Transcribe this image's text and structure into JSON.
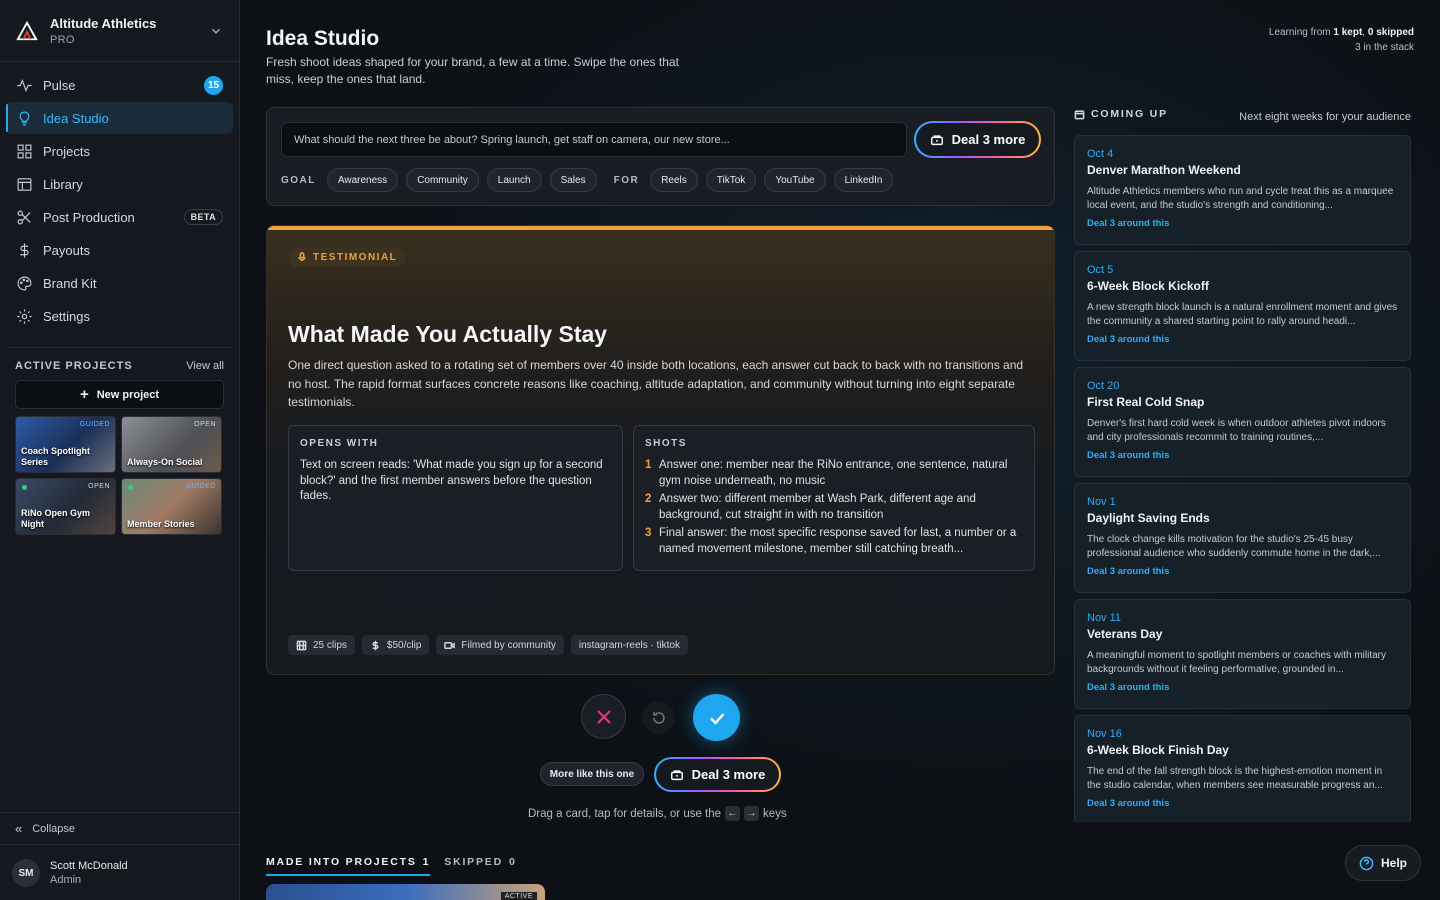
{
  "brand": {
    "name": "Altitude Athletics",
    "plan": "PRO"
  },
  "nav": [
    {
      "label": "Pulse",
      "icon": "pulse-icon",
      "badge": "15"
    },
    {
      "label": "Idea Studio",
      "icon": "lightbulb-icon",
      "active": true
    },
    {
      "label": "Projects",
      "icon": "grid-icon"
    },
    {
      "label": "Library",
      "icon": "library-icon"
    },
    {
      "label": "Post Production",
      "icon": "scissors-icon",
      "tag": "BETA"
    },
    {
      "label": "Payouts",
      "icon": "dollar-icon"
    },
    {
      "label": "Brand Kit",
      "icon": "palette-icon"
    },
    {
      "label": "Settings",
      "icon": "gear-icon"
    }
  ],
  "active_projects": {
    "title": "ACTIVE PROJECTS",
    "view_all": "View all",
    "new_project": "New project",
    "items": [
      {
        "label": "Coach Spotlight Series",
        "status": "GUIDED"
      },
      {
        "label": "Always-On Social",
        "status": "OPEN"
      },
      {
        "label": "RiNo Open Gym Night",
        "status": "OPEN"
      },
      {
        "label": "Member Stories",
        "status": "GUIDED"
      }
    ]
  },
  "collapse_label": "Collapse",
  "user": {
    "initials": "SM",
    "name": "Scott McDonald",
    "role": "Admin"
  },
  "header": {
    "title": "Idea Studio",
    "subtitle": "Fresh shoot ideas shaped for your brand, a few at a time. Swipe the ones that miss, keep the ones that land.",
    "learning_prefix": "Learning from",
    "learning_kept": "1 kept",
    "learning_skipped": "0 skipped",
    "stack": "3 in the stack"
  },
  "prompt": {
    "placeholder": "What should the next three be about? Spring launch, get staff on camera, our new store...",
    "deal_label": "Deal 3 more",
    "goal_label": "GOAL",
    "goals": [
      "Awareness",
      "Community",
      "Launch",
      "Sales"
    ],
    "for_label": "FOR",
    "platforms": [
      "Reels",
      "TikTok",
      "YouTube",
      "LinkedIn"
    ]
  },
  "card": {
    "tag": "TESTIMONIAL",
    "title": "What Made You Actually Stay",
    "description": "One direct question asked to a rotating set of members over 40 inside both locations, each answer cut back to back with no transitions and no host. The rapid format surfaces concrete reasons like coaching, altitude adaptation, and community without turning into eight separate testimonials.",
    "opens_with_head": "OPENS WITH",
    "opens_with": "Text on screen reads: 'What made you sign up for a second block?' and the first member answers before the question fades.",
    "shots_head": "SHOTS",
    "shots": [
      "Answer one: member near the RiNo entrance, one sentence, natural gym noise underneath, no music",
      "Answer two: different member at Wash Park, different age and background, cut straight in with no transition",
      "Final answer: the most specific response saved for last, a number or a named movement milestone, member still catching breath..."
    ],
    "meta": {
      "clips": "25 clips",
      "rate": "$50/clip",
      "filmed_by": "Filmed by community",
      "platforms": "instagram-reels · tiktok"
    },
    "accent": "#f2a13a"
  },
  "actions": {
    "more_like": "More like this one",
    "deal_label": "Deal 3 more",
    "hint_before": "Drag a card, tap for details, or use the",
    "hint_after": "keys",
    "key_left": "←",
    "key_right": "→"
  },
  "tabs": [
    {
      "label": "MADE INTO PROJECTS",
      "count": "1",
      "active": true
    },
    {
      "label": "SKIPPED",
      "count": "0"
    }
  ],
  "peek_status": "ACTIVE",
  "coming_up": {
    "title": "COMING UP",
    "subtitle": "Next eight weeks for your audience",
    "link_label": "Deal 3 around this",
    "events": [
      {
        "date": "Oct 4",
        "title": "Denver Marathon Weekend",
        "desc": "Altitude Athletics members who run and cycle treat this as a marquee local event, and the studio's strength and conditioning..."
      },
      {
        "date": "Oct 5",
        "title": "6-Week Block Kickoff",
        "desc": "A new strength block launch is a natural enrollment moment and gives the community a shared starting point to rally around headi..."
      },
      {
        "date": "Oct 20",
        "title": "First Real Cold Snap",
        "desc": "Denver's first hard cold week is when outdoor athletes pivot indoors and city professionals recommit to training routines,..."
      },
      {
        "date": "Nov 1",
        "title": "Daylight Saving Ends",
        "desc": "The clock change kills motivation for the studio's 25-45 busy professional audience who suddenly commute home in the dark,..."
      },
      {
        "date": "Nov 11",
        "title": "Veterans Day",
        "desc": "A meaningful moment to spotlight members or coaches with military backgrounds without it feeling performative, grounded in..."
      },
      {
        "date": "Nov 16",
        "title": "6-Week Block Finish Day",
        "desc": "The end of the fall strength block is the highest-emotion moment in the studio calendar, when members see measurable progress an..."
      }
    ]
  },
  "help_label": "Help",
  "colors": {
    "accent": "#1ea7ee",
    "testimonial": "#f2a13a",
    "link": "#2eaef5"
  }
}
